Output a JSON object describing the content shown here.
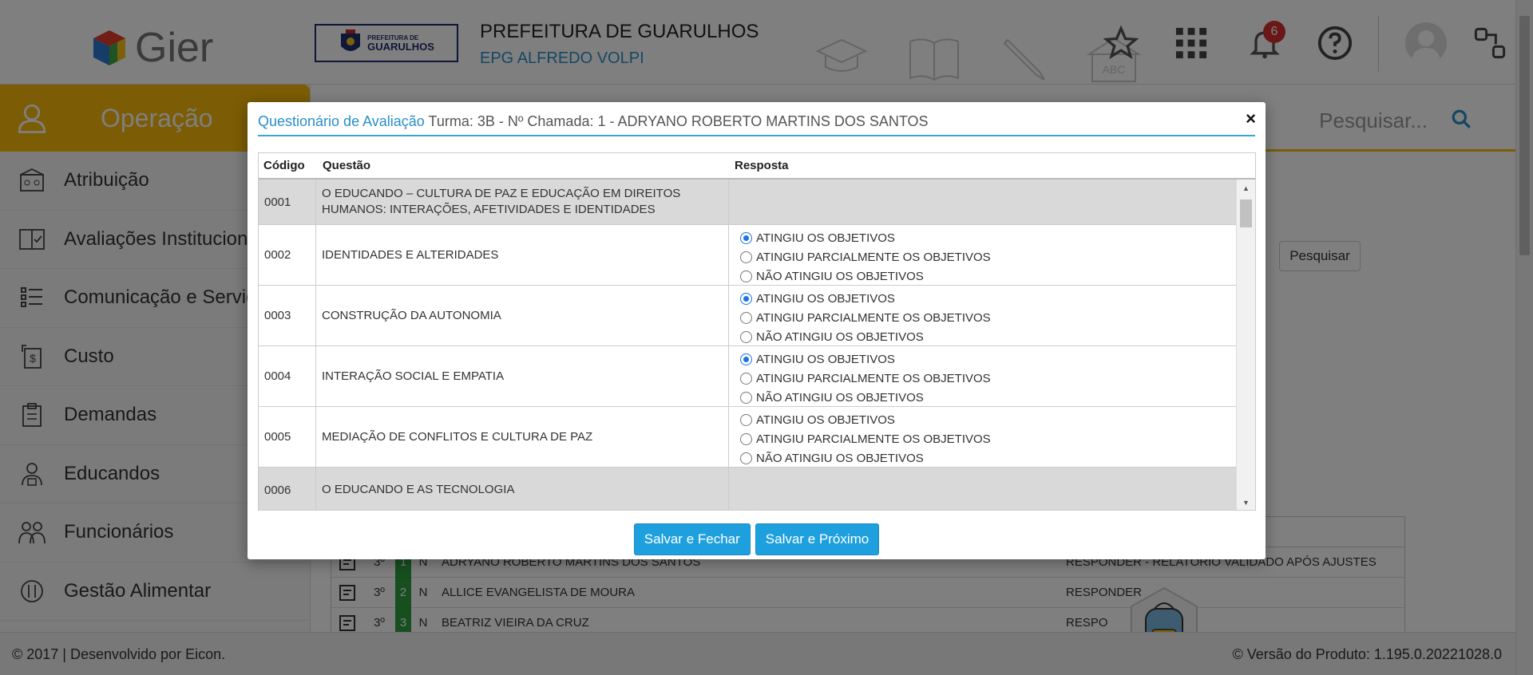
{
  "header": {
    "brand": "Gier",
    "crest_text": "GUARULHOS",
    "crest_small": "PREFEITURA DE",
    "institution": "PREFEITURA DE GUARULHOS",
    "school": "EPG ALFREDO VOLPI",
    "notification_count": "6",
    "bg_icon_abc": "ABC"
  },
  "sidebar": {
    "section": "Operação",
    "items": [
      {
        "label": "Atribuição",
        "icon": "school-building-icon"
      },
      {
        "label": "Avaliações Institucionais",
        "icon": "evaluation-book-icon"
      },
      {
        "label": "Comunicação e Serviços",
        "icon": "checklist-icon"
      },
      {
        "label": "Custo",
        "icon": "money-icon"
      },
      {
        "label": "Demandas",
        "icon": "clipboard-icon"
      },
      {
        "label": "Educandos",
        "icon": "student-icon"
      },
      {
        "label": "Funcionários",
        "icon": "staff-icon"
      },
      {
        "label": "Gestão Alimentar",
        "icon": "food-icon"
      }
    ]
  },
  "search": {
    "placeholder": "Pesquisar...",
    "button": "Pesquisar"
  },
  "background_table": {
    "rows": [
      {
        "ano": "3º",
        "num": "1",
        "n": "N",
        "name": "ADRYANO ROBERTO MARTINS DOS SANTOS",
        "action": "RESPONDER - RELATÓRIO VALIDADO APÓS AJUSTES"
      },
      {
        "ano": "3º",
        "num": "2",
        "n": "N",
        "name": "ALLICE EVANGELISTA DE MOURA",
        "action": "RESPONDER"
      },
      {
        "ano": "3º",
        "num": "3",
        "n": "N",
        "name": "BEATRIZ VIEIRA DA CRUZ",
        "action": "RESPO"
      }
    ]
  },
  "footer": {
    "left": "© 2017 | Desenvolvido por Eicon.",
    "right": "© Versão do Produto: 1.195.0.20221028.0"
  },
  "modal": {
    "title_link": "Questionário de Avaliação",
    "title_rest": " Turma: 3B - Nº Chamada: 1 - ADRYANO ROBERTO MARTINS DOS SANTOS",
    "close": "×",
    "columns": {
      "code": "Código",
      "question": "Questão",
      "answer": "Resposta"
    },
    "options": [
      "ATINGIU OS OBJETIVOS",
      "ATINGIU PARCIALMENTE OS OBJETIVOS",
      "NÃO ATINGIU OS OBJETIVOS"
    ],
    "rows": [
      {
        "code": "0001",
        "question": "O EDUCANDO – CULTURA DE PAZ E EDUCAÇÃO EM DIREITOS HUMANOS: INTERAÇÕES, AFETIVIDADES E IDENTIDADES",
        "section": true
      },
      {
        "code": "0002",
        "question": "IDENTIDADES E ALTERIDADES",
        "section": false,
        "selected": 0
      },
      {
        "code": "0003",
        "question": "CONSTRUÇÃO DA AUTONOMIA",
        "section": false,
        "selected": 0
      },
      {
        "code": "0004",
        "question": "INTERAÇÃO SOCIAL E EMPATIA",
        "section": false,
        "selected": 0
      },
      {
        "code": "0005",
        "question": "MEDIAÇÃO DE CONFLITOS E CULTURA DE PAZ",
        "section": false,
        "selected": -1
      },
      {
        "code": "0006",
        "question": "O EDUCANDO E AS TECNOLOGIA",
        "section": true
      }
    ],
    "buttons": {
      "save_close": "Salvar e Fechar",
      "save_next": "Salvar e Próximo"
    }
  },
  "colors": {
    "accent": "#f9b808",
    "primary": "#1ea0de",
    "link": "#2a8ec9",
    "green": "#2e9e3f"
  }
}
